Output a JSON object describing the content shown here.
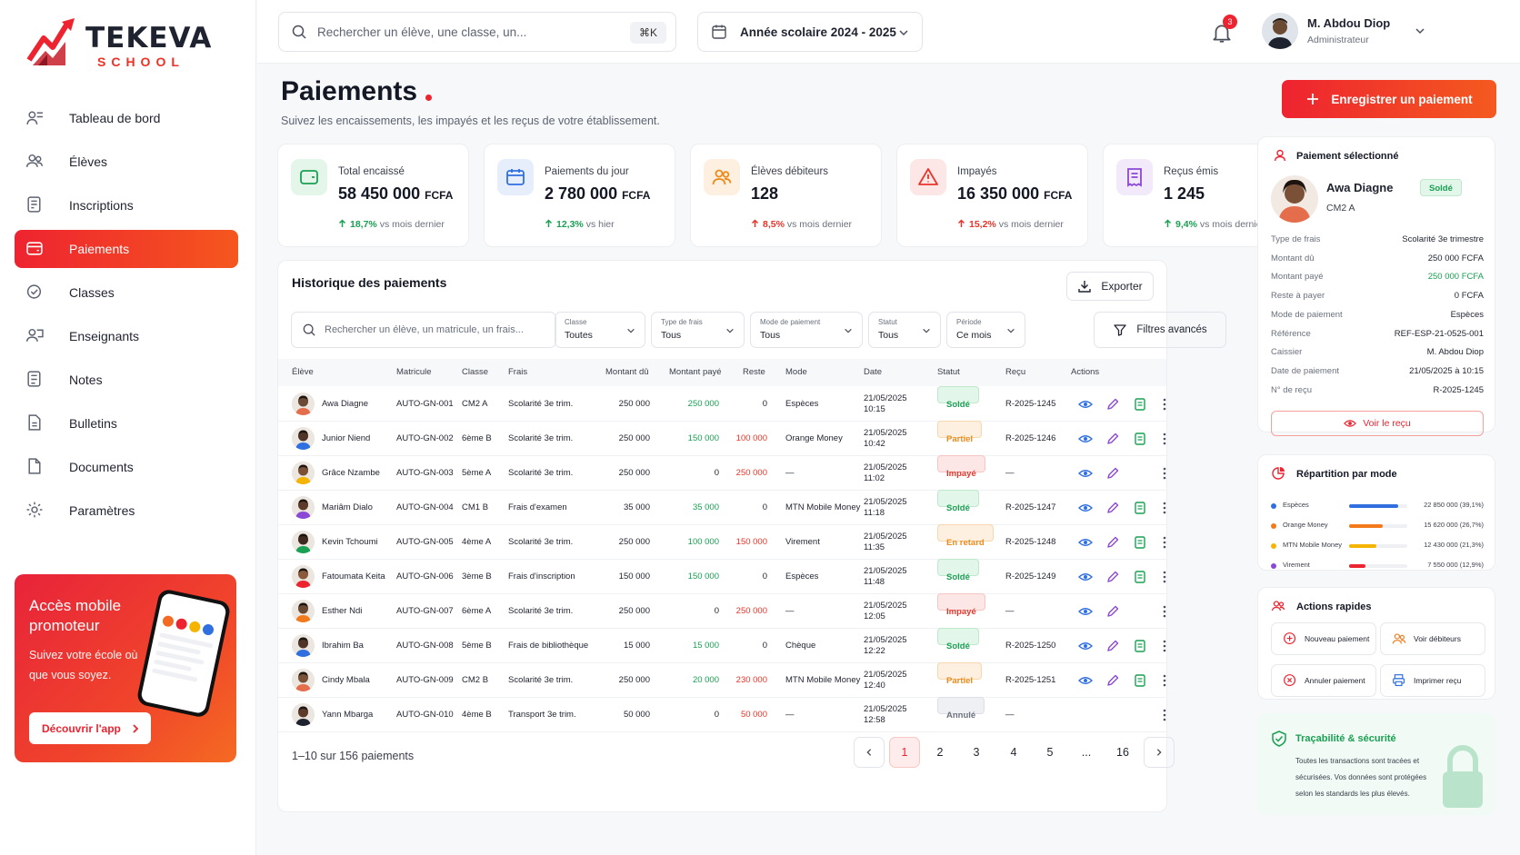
{
  "brand": {
    "name": "TEKEVA",
    "sub": "SCHOOL"
  },
  "nav": [
    {
      "label": "Tableau de bord",
      "icon": "dashboard-icon"
    },
    {
      "label": "Élèves",
      "icon": "users-icon"
    },
    {
      "label": "Inscriptions",
      "icon": "inscription-icon"
    },
    {
      "label": "Paiements",
      "icon": "wallet-icon",
      "active": true
    },
    {
      "label": "Classes",
      "icon": "class-icon"
    },
    {
      "label": "Enseignants",
      "icon": "teacher-icon"
    },
    {
      "label": "Notes",
      "icon": "notes-icon"
    },
    {
      "label": "Bulletins",
      "icon": "bulletin-icon"
    },
    {
      "label": "Documents",
      "icon": "document-icon"
    },
    {
      "label": "Paramètres",
      "icon": "gear-icon"
    }
  ],
  "promo": {
    "title": "Accès mobile promoteur",
    "text": "Suivez votre école où que vous soyez.",
    "button": "Découvrir l'app"
  },
  "top": {
    "search_placeholder": "Rechercher un élève, une classe, un...",
    "kbd": "⌘K",
    "year": "Année scolaire 2024 - 2025",
    "notif_count": "3",
    "user_name": "M. Abdou Diop",
    "user_role": "Administrateur"
  },
  "page": {
    "title": "Paiements",
    "subtitle": "Suivez les encaissements, les impayés et les reçus de votre établissement.",
    "cta": "Enregistrer un paiement"
  },
  "kpis": [
    {
      "label": "Total encaissé",
      "value": "58 450 000",
      "unit": "FCFA",
      "trend": "18,7%",
      "trend_text": "vs mois dernier",
      "color": "#1aa053",
      "bg": "#e4f6ea"
    },
    {
      "label": "Paiements du jour",
      "value": "2 780 000",
      "unit": "FCFA",
      "trend": "12,3%",
      "trend_text": "vs hier",
      "color": "#2f6fe0",
      "bg": "#e6eefc"
    },
    {
      "label": "Élèves débiteurs",
      "value": "128",
      "unit": "",
      "trend": "8,5%",
      "trend_text": "vs mois dernier",
      "color": "#ec8a1b",
      "bg": "#fdf0e0"
    },
    {
      "label": "Impayés",
      "value": "16 350 000",
      "unit": "FCFA",
      "trend": "15,2%",
      "trend_text": "vs mois dernier",
      "color": "#e8352b",
      "bg": "#fde7e6"
    },
    {
      "label": "Reçus émis",
      "value": "1 245",
      "unit": "",
      "trend": "9,4%",
      "trend_text": "vs mois dernier",
      "color": "#8b47d6",
      "bg": "#f2e9fb"
    }
  ],
  "history": {
    "title": "Historique des paiements",
    "export": "Exporter",
    "search_placeholder": "Rechercher un élève, un matricule, un frais...",
    "filters": [
      {
        "label": "Classe",
        "value": "Toutes"
      },
      {
        "label": "Type de frais",
        "value": "Tous"
      },
      {
        "label": "Mode de paiement",
        "value": "Tous"
      },
      {
        "label": "Statut",
        "value": "Tous"
      },
      {
        "label": "Période",
        "value": "Ce mois"
      }
    ],
    "advanced": "Filtres avancés",
    "columns": [
      "Élève",
      "Matricule",
      "Classe",
      "Frais",
      "Montant dû",
      "Montant payé",
      "Reste",
      "Mode",
      "Date",
      "Statut",
      "Reçu",
      "Actions"
    ],
    "rows": [
      {
        "eleve": "Awa Diagne",
        "mat": "AUTO-GN-001",
        "classe": "CM2 A",
        "frais": "Scolarité 3e trim.",
        "du": "250 000",
        "paye": "250 000",
        "reste": "0",
        "mode": "Espèces",
        "date": "21/05/2025",
        "heure": "10:15",
        "statut": "Soldé",
        "recu": "R-2025-1245"
      },
      {
        "eleve": "Junior Niend",
        "mat": "AUTO-GN-002",
        "classe": "6ème B",
        "frais": "Scolarité 3e trim.",
        "du": "250 000",
        "paye": "150 000",
        "reste": "100 000",
        "mode": "Orange Money",
        "date": "21/05/2025",
        "heure": "10:42",
        "statut": "Partiel",
        "recu": "R-2025-1246"
      },
      {
        "eleve": "Grâce Nzambe",
        "mat": "AUTO-GN-003",
        "classe": "5ème A",
        "frais": "Scolarité 3e trim.",
        "du": "250 000",
        "paye": "0",
        "reste": "250 000",
        "mode": "—",
        "date": "21/05/2025",
        "heure": "11:02",
        "statut": "Impayé",
        "recu": "—"
      },
      {
        "eleve": "Mariâm Dialo",
        "mat": "AUTO-GN-004",
        "classe": "CM1 B",
        "frais": "Frais d'examen",
        "du": "35 000",
        "paye": "35 000",
        "reste": "0",
        "mode": "MTN Mobile Money",
        "date": "21/05/2025",
        "heure": "11:18",
        "statut": "Soldé",
        "recu": "R-2025-1247"
      },
      {
        "eleve": "Kevin Tchoumi",
        "mat": "AUTO-GN-005",
        "classe": "4ème A",
        "frais": "Scolarité 3e trim.",
        "du": "250 000",
        "paye": "100 000",
        "reste": "150 000",
        "mode": "Virement",
        "date": "21/05/2025",
        "heure": "11:35",
        "statut": "En retard",
        "recu": "R-2025-1248"
      },
      {
        "eleve": "Fatoumata Keita",
        "mat": "AUTO-GN-006",
        "classe": "3ème B",
        "frais": "Frais d'inscription",
        "du": "150 000",
        "paye": "150 000",
        "reste": "0",
        "mode": "Espèces",
        "date": "21/05/2025",
        "heure": "11:48",
        "statut": "Soldé",
        "recu": "R-2025-1249"
      },
      {
        "eleve": "Esther Ndi",
        "mat": "AUTO-GN-007",
        "classe": "6ème A",
        "frais": "Scolarité 3e trim.",
        "du": "250 000",
        "paye": "0",
        "reste": "250 000",
        "mode": "—",
        "date": "21/05/2025",
        "heure": "12:05",
        "statut": "Impayé",
        "recu": "—"
      },
      {
        "eleve": "Ibrahim Ba",
        "mat": "AUTO-GN-008",
        "classe": "5ème B",
        "frais": "Frais de bibliothèque",
        "du": "15 000",
        "paye": "15 000",
        "reste": "0",
        "mode": "Chèque",
        "date": "21/05/2025",
        "heure": "12:22",
        "statut": "Soldé",
        "recu": "R-2025-1250"
      },
      {
        "eleve": "Cindy Mbala",
        "mat": "AUTO-GN-009",
        "classe": "CM2 B",
        "frais": "Scolarité 3e trim.",
        "du": "250 000",
        "paye": "20 000",
        "reste": "230 000",
        "mode": "MTN Mobile Money",
        "date": "21/05/2025",
        "heure": "12:40",
        "statut": "Partiel",
        "recu": "R-2025-1251"
      },
      {
        "eleve": "Yann Mbarga",
        "mat": "AUTO-GN-010",
        "classe": "4ème B",
        "frais": "Transport 3e trim.",
        "du": "50 000",
        "paye": "0",
        "reste": "50 000",
        "mode": "—",
        "date": "21/05/2025",
        "heure": "12:58",
        "statut": "Annulé",
        "recu": "—"
      }
    ],
    "pager_text": "1–10 sur 156 paiements",
    "pages": [
      "1",
      "2",
      "3",
      "4",
      "5",
      "...",
      "16"
    ]
  },
  "selected": {
    "title": "Paiement sélectionné",
    "name": "Awa Diagne",
    "classe": "CM2 A",
    "badge": "Soldé",
    "details": [
      {
        "k": "Type de frais",
        "v": "Scolarité 3e trimestre"
      },
      {
        "k": "Montant dû",
        "v": "250 000 FCFA"
      },
      {
        "k": "Montant payé",
        "v": "250 000 FCFA",
        "green": true
      },
      {
        "k": "Reste à payer",
        "v": "0 FCFA"
      },
      {
        "k": "Mode de paiement",
        "v": "Espèces"
      },
      {
        "k": "Référence",
        "v": "REF-ESP-21-0525-001"
      },
      {
        "k": "Caissier",
        "v": "M. Abdou Diop"
      },
      {
        "k": "Date de paiement",
        "v": "21/05/2025 à 10:15"
      },
      {
        "k": "N° de reçu",
        "v": "R-2025-1245"
      }
    ],
    "button": "Voir le reçu"
  },
  "repartition": {
    "title": "Répartition par mode",
    "items": [
      {
        "label": "Espèces",
        "amount": "22 850 000 (39,1%)",
        "share": 0.391,
        "color": "#2f6fe0"
      },
      {
        "label": "Orange Money",
        "amount": "15 620 000 (26,7%)",
        "share": 0.267,
        "color": "#f27a1a"
      },
      {
        "label": "MTN Mobile Money",
        "amount": "12 430 000 (21,3%)",
        "share": 0.213,
        "color": "#f4b400"
      },
      {
        "label": "Virement",
        "amount": "7 550 000 (12,9%)",
        "share": 0.129,
        "color": "#ee2330"
      }
    ],
    "dot_colors": [
      "#2f6fe0",
      "#f27a1a",
      "#f4b400",
      "#8b47d6"
    ]
  },
  "quick": {
    "title": "Actions rapides",
    "items": [
      {
        "label": "Nouveau paiement",
        "icon": "plus-circle-icon"
      },
      {
        "label": "Voir débiteurs",
        "icon": "users-icon"
      },
      {
        "label": "Annuler paiement",
        "icon": "x-circle-icon"
      },
      {
        "label": "Imprimer reçu",
        "icon": "printer-icon"
      }
    ]
  },
  "trace": {
    "title": "Traçabilité & sécurité",
    "text": "Toutes les transactions sont tracées et sécurisées. Vos données sont protégées selon les standards les plus élevés."
  }
}
